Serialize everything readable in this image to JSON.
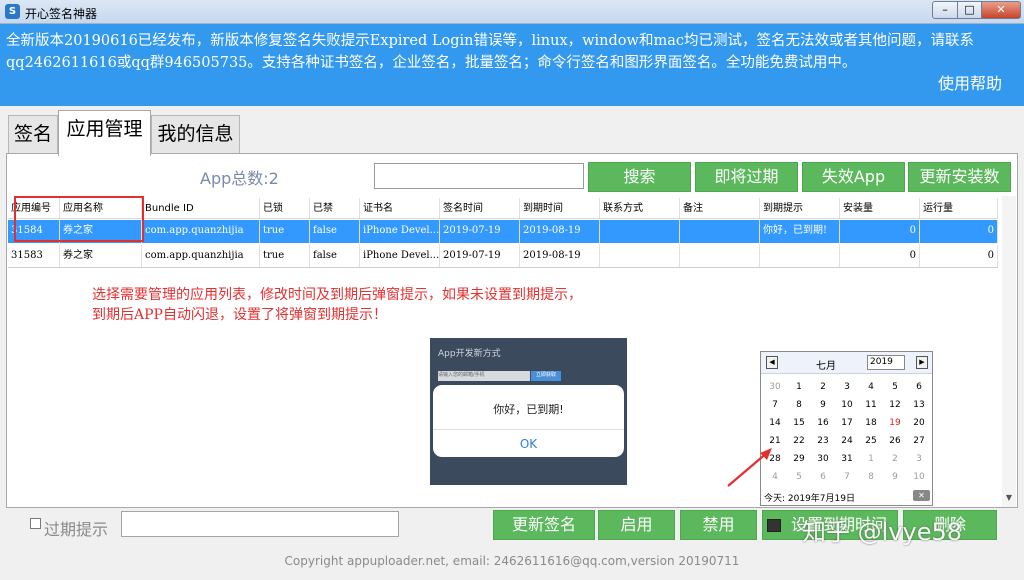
{
  "window": {
    "title": "开心签名神器",
    "icon_glyph": "S",
    "minimize": "–",
    "maximize": "□",
    "close": "✕"
  },
  "banner": {
    "text": "全新版本20190616已经发布，新版本修复签名失败提示Expired Login错误等，linux，window和mac均已测试，签名无法效或者其他问题，请联系qq2462611616或qq群946505735。支持各种证书签名，企业签名，批量签名；命令行签名和图形界面签名。全功能免费试用中。",
    "help": "使用帮助",
    "bg": "#3399ee"
  },
  "tabs": {
    "sign": "签名",
    "apps": "应用管理",
    "info": "我的信息"
  },
  "toolbar": {
    "count": "App总数:2",
    "search_value": "",
    "search": "搜索",
    "expiring": "即将过期",
    "invalid": "失效App",
    "update_installs": "更新安装数"
  },
  "table": {
    "headers": [
      "应用编号",
      "应用名称",
      "Bundle ID",
      "已锁",
      "已禁",
      "证书名",
      "签名时间",
      "到期时间",
      "联系方式",
      "备注",
      "到期提示",
      "安装量",
      "运行量"
    ],
    "rows": [
      [
        "31584",
        "券之家",
        "com.app.quanzhijia",
        "true",
        "false",
        "iPhone Devel...",
        "2019-07-19",
        "2019-08-19",
        "",
        "",
        "你好，已到期!",
        "0",
        "0"
      ],
      [
        "31583",
        "券之家",
        "com.app.quanzhijia",
        "true",
        "false",
        "iPhone Devel...",
        "2019-07-19",
        "2019-08-19",
        "",
        "",
        "",
        "0",
        "0"
      ]
    ],
    "selected_row": 0,
    "selected_color": "#3399ff"
  },
  "instruction": {
    "line1": "选择需要管理的应用列表，修改时间及到期后弹窗提示，如果未设置到期提示，",
    "line2": "到期后APP自动闪退，设置了将弹窗到期提示！",
    "color": "#e53030"
  },
  "phone_preview": {
    "title": "App开发新方式",
    "field": "请输入您的邮箱/手机",
    "button": "立即获取",
    "dialog_message": "你好，已到期!",
    "dialog_ok": "OK"
  },
  "calendar": {
    "prev": "◀",
    "next": "▶",
    "month": "七月",
    "year": "2019",
    "weeks": [
      [
        "30",
        "1",
        "2",
        "3",
        "4",
        "5",
        "6"
      ],
      [
        "7",
        "8",
        "9",
        "10",
        "11",
        "12",
        "13"
      ],
      [
        "14",
        "15",
        "16",
        "17",
        "18",
        "19",
        "20"
      ],
      [
        "21",
        "22",
        "23",
        "24",
        "25",
        "26",
        "27"
      ],
      [
        "28",
        "29",
        "30",
        "31",
        "1",
        "2",
        "3"
      ],
      [
        "4",
        "5",
        "6",
        "7",
        "8",
        "9",
        "10"
      ]
    ],
    "today_label": "今天: 2019年7月19日",
    "clear": "✕",
    "today_color": "#e02020"
  },
  "scroll": {
    "down": "▼"
  },
  "bottom": {
    "expire_label": "过期提示",
    "expire_value": "",
    "resign": "更新签名",
    "enable": "启用",
    "disable": "禁用",
    "set_expiry": "设置到期时间",
    "delete": "删除",
    "watermark": "知乎 @lvye58"
  },
  "footer": {
    "copyright": "Copyright appuploader.net, email: 2462611616@qq.com,version 20190711"
  },
  "colors": {
    "button_green": "#5cb85c",
    "highlight_red": "#e03030"
  }
}
